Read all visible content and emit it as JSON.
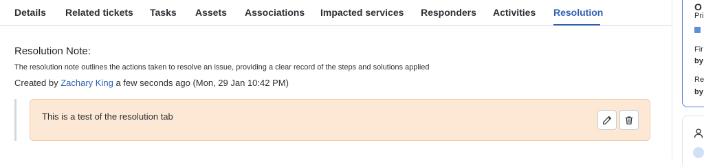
{
  "tabs": [
    {
      "label": "Details"
    },
    {
      "label": "Related tickets"
    },
    {
      "label": "Tasks"
    },
    {
      "label": "Assets"
    },
    {
      "label": "Associations"
    },
    {
      "label": "Impacted services"
    },
    {
      "label": "Responders"
    },
    {
      "label": "Activities"
    },
    {
      "label": "Resolution",
      "active": true
    }
  ],
  "resolution": {
    "title": "Resolution Note:",
    "description": "The resolution note outlines the actions taken to resolve an issue, providing a clear record of the steps and solutions applied",
    "created_prefix": "Created by",
    "author": "Zachary King",
    "created_suffix": "a few seconds ago (Mon, 29 Jan 10:42 PM)",
    "note_text": "This is a test of the resolution tab",
    "edit_icon": "pencil-icon",
    "delete_icon": "trash-icon"
  },
  "side_panel": {
    "field_1_label": "Pri",
    "field_2_label": "Fir",
    "field_2_value": "by",
    "field_3_label": "Re",
    "field_3_value": "by",
    "header_partial": "O"
  },
  "colors": {
    "accent": "#2f5fb3",
    "note_background": "#fde8d6",
    "note_border": "#f0c9a4"
  }
}
